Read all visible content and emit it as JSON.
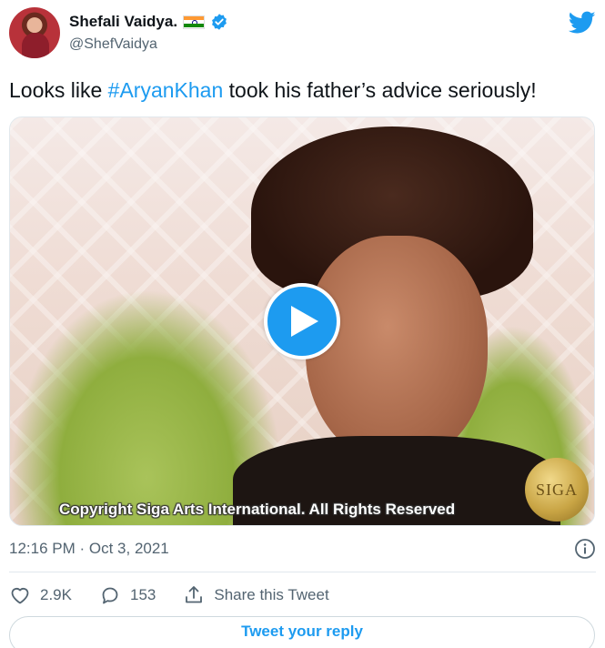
{
  "author": {
    "display_name": "Shefali Vaidya.",
    "handle": "@ShefVaidya",
    "flag_icon": "india-flag-icon",
    "verified_icon": "verified-badge-icon"
  },
  "tweet": {
    "text_before": "Looks like ",
    "hashtag": "#AryanKhan",
    "text_after": " took his father’s advice seriously!"
  },
  "media": {
    "type": "video",
    "watermark_text": "Copyright Siga Arts International. All Rights Reserved",
    "seal_text": "SIGA"
  },
  "meta": {
    "timestamp": "12:16 PM · Oct 3, 2021"
  },
  "actions": {
    "likes": "2.9K",
    "replies": "153",
    "share_label": "Share this Tweet"
  },
  "reply": {
    "button_label": "Tweet your reply"
  },
  "colors": {
    "accent": "#1d9bf0",
    "text_primary": "#0f1419",
    "text_secondary": "#536471",
    "border": "#cfd9de"
  }
}
